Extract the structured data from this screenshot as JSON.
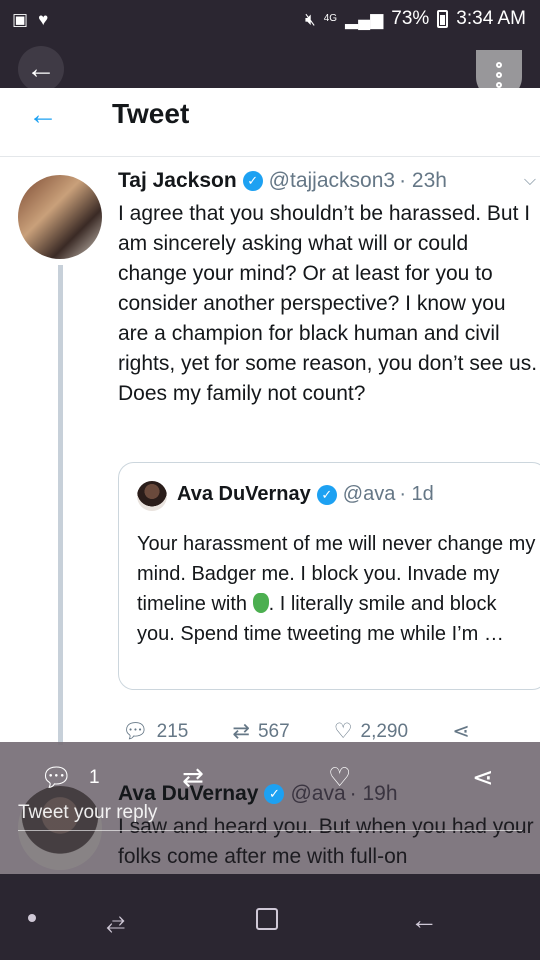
{
  "status_bar": {
    "battery": "73%",
    "time": "3:34 AM",
    "signal_label": "4G",
    "icons": [
      "image-icon",
      "heart-icon",
      "mute-icon",
      "signal-icon",
      "battery-icon"
    ]
  },
  "viewer": {
    "back_icon": "back-arrow-icon",
    "more_icon": "more-vertical-icon"
  },
  "header": {
    "title": "Tweet"
  },
  "tweet": {
    "name": "Taj Jackson",
    "handle": "@tajjackson3",
    "time": "· 23h",
    "text": "I agree that you shouldn’t be harassed. But I am sincerely asking what will or could change your mind? Or at least for you to consider another perspective? I know you are a champion for black human and civil rights, yet for some reason, you don’t see us. Does my family not count?",
    "quote": {
      "name": "Ava DuVernay",
      "handle": "@ava",
      "time": "· 1d",
      "text_before": "Your harassment of me will never change my mind. Badger me. I block you. Invade my timeline with",
      "text_after": ". I literally smile and block you. Spend time tweeting me while I’m …"
    },
    "stats": {
      "replies": "215",
      "retweets": "567",
      "likes": "2,290"
    }
  },
  "overlay": {
    "reply_count": "1",
    "reply_placeholder": "Tweet your reply"
  },
  "next_tweet": {
    "name": "Ava DuVernay",
    "handle": "@ava",
    "time": "· 19h",
    "text": "I saw and heard you. But when you had your folks come after me with full-on"
  },
  "colors": {
    "twitter_blue": "#1da1f2",
    "system_bar": "#2b2631",
    "overlay": "#766e76"
  }
}
